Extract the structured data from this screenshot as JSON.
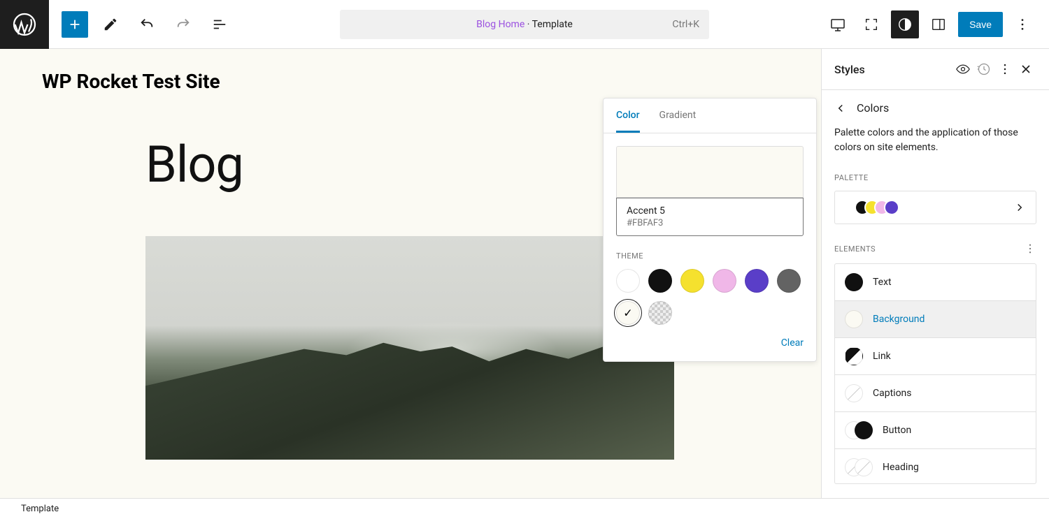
{
  "topbar": {
    "center_link": "Blog Home",
    "center_suffix": " · Template",
    "shortcut": "Ctrl+K",
    "save_label": "Save"
  },
  "canvas": {
    "site_title": "WP Rocket Test Site",
    "heading": "Blog"
  },
  "color_popover": {
    "tabs": {
      "color": "Color",
      "gradient": "Gradient"
    },
    "active_tab": "color",
    "swatch": {
      "name": "Accent 5",
      "hex": "#FBFAF3",
      "color": "#FBFAF3"
    },
    "theme_label": "THEME",
    "theme_colors": [
      {
        "color": "#FFFFFF"
      },
      {
        "color": "#111111"
      },
      {
        "color": "#F5E12E"
      },
      {
        "color": "#F0B7E8"
      },
      {
        "color": "#5A3EC8"
      },
      {
        "color": "#636363"
      }
    ],
    "theme_row2": [
      {
        "color": "#FBFAF3",
        "selected": true
      },
      {
        "checker": true
      }
    ],
    "clear_label": "Clear"
  },
  "sidebar": {
    "title": "Styles",
    "crumb": "Colors",
    "description": "Palette colors and the application of those colors on site elements.",
    "palette_label": "PALETTE",
    "palette_colors": [
      "#FFFFFF",
      "#111111",
      "#F5E12E",
      "#F0B7E8",
      "#5A3EC8"
    ],
    "elements_label": "ELEMENTS",
    "elements": [
      {
        "label": "Text",
        "swatch": "single-black"
      },
      {
        "label": "Background",
        "swatch": "single-light",
        "selected": true
      },
      {
        "label": "Link",
        "swatch": "split"
      },
      {
        "label": "Captions",
        "swatch": "empty"
      },
      {
        "label": "Button",
        "swatch": "pair"
      },
      {
        "label": "Heading",
        "swatch": "pair-empty"
      }
    ]
  },
  "footer": {
    "breadcrumb": "Template"
  }
}
